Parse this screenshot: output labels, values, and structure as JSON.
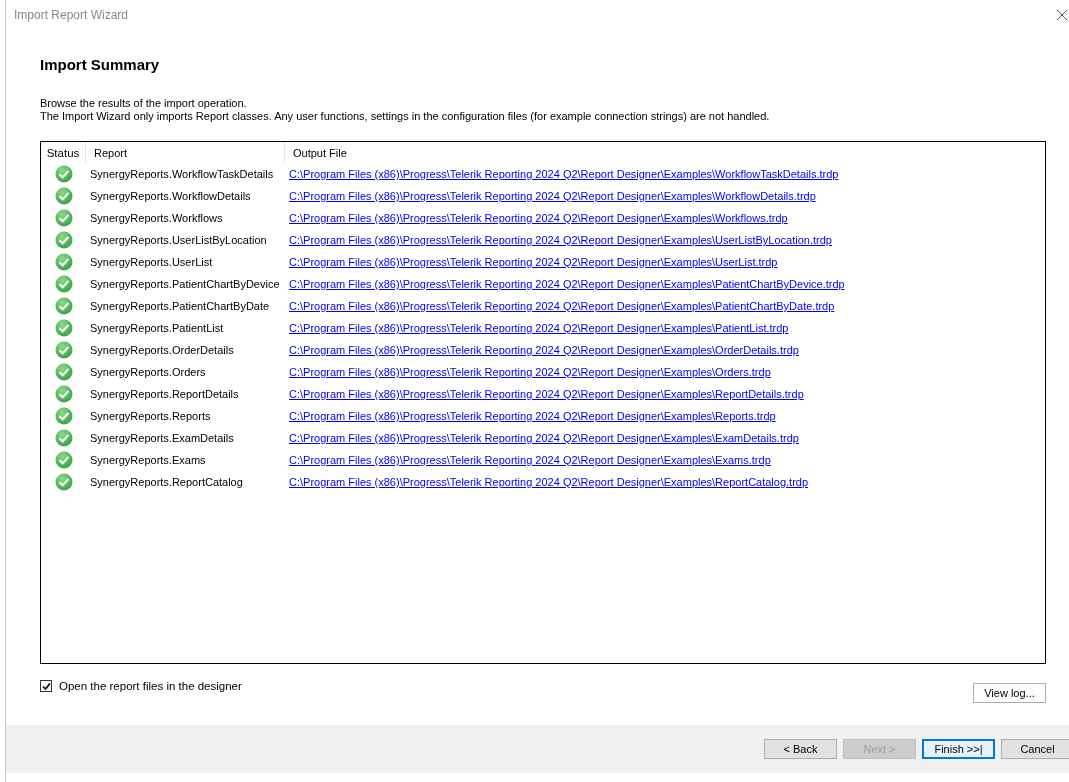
{
  "window": {
    "title": "Import Report Wizard"
  },
  "page": {
    "heading": "Import Summary",
    "intro": [
      "Browse the results of the import operation.",
      "The Import Wizard only imports Report classes. Any user functions, settings in the configuration files (for example connection strings) are not handled."
    ]
  },
  "table": {
    "columns": [
      "Status",
      "Report",
      "Output File"
    ],
    "rows": [
      {
        "succeeded": true,
        "report": "SynergyReports.WorkflowTaskDetails",
        "output_file": "C:\\Program Files (x86)\\Progress\\Telerik Reporting 2024 Q2\\Report Designer\\Examples\\WorkflowTaskDetails.trdp"
      },
      {
        "succeeded": true,
        "report": "SynergyReports.WorkflowDetails",
        "output_file": "C:\\Program Files (x86)\\Progress\\Telerik Reporting 2024 Q2\\Report Designer\\Examples\\WorkflowDetails.trdp"
      },
      {
        "succeeded": true,
        "report": "SynergyReports.Workflows",
        "output_file": "C:\\Program Files (x86)\\Progress\\Telerik Reporting 2024 Q2\\Report Designer\\Examples\\Workflows.trdp"
      },
      {
        "succeeded": true,
        "report": "SynergyReports.UserListByLocation",
        "output_file": "C:\\Program Files (x86)\\Progress\\Telerik Reporting 2024 Q2\\Report Designer\\Examples\\UserListByLocation.trdp"
      },
      {
        "succeeded": true,
        "report": "SynergyReports.UserList",
        "output_file": "C:\\Program Files (x86)\\Progress\\Telerik Reporting 2024 Q2\\Report Designer\\Examples\\UserList.trdp"
      },
      {
        "succeeded": true,
        "report": "SynergyReports.PatientChartByDevice",
        "output_file": "C:\\Program Files (x86)\\Progress\\Telerik Reporting 2024 Q2\\Report Designer\\Examples\\PatientChartByDevice.trdp"
      },
      {
        "succeeded": true,
        "report": "SynergyReports.PatientChartByDate",
        "output_file": "C:\\Program Files (x86)\\Progress\\Telerik Reporting 2024 Q2\\Report Designer\\Examples\\PatientChartByDate.trdp"
      },
      {
        "succeeded": true,
        "report": "SynergyReports.PatientList",
        "output_file": "C:\\Program Files (x86)\\Progress\\Telerik Reporting 2024 Q2\\Report Designer\\Examples\\PatientList.trdp"
      },
      {
        "succeeded": true,
        "report": "SynergyReports.OrderDetails",
        "output_file": "C:\\Program Files (x86)\\Progress\\Telerik Reporting 2024 Q2\\Report Designer\\Examples\\OrderDetails.trdp"
      },
      {
        "succeeded": true,
        "report": "SynergyReports.Orders",
        "output_file": "C:\\Program Files (x86)\\Progress\\Telerik Reporting 2024 Q2\\Report Designer\\Examples\\Orders.trdp"
      },
      {
        "succeeded": true,
        "report": "SynergyReports.ReportDetails",
        "output_file": "C:\\Program Files (x86)\\Progress\\Telerik Reporting 2024 Q2\\Report Designer\\Examples\\ReportDetails.trdp"
      },
      {
        "succeeded": true,
        "report": "SynergyReports.Reports",
        "output_file": "C:\\Program Files (x86)\\Progress\\Telerik Reporting 2024 Q2\\Report Designer\\Examples\\Reports.trdp"
      },
      {
        "succeeded": true,
        "report": "SynergyReports.ExamDetails",
        "output_file": "C:\\Program Files (x86)\\Progress\\Telerik Reporting 2024 Q2\\Report Designer\\Examples\\ExamDetails.trdp"
      },
      {
        "succeeded": true,
        "report": "SynergyReports.Exams",
        "output_file": "C:\\Program Files (x86)\\Progress\\Telerik Reporting 2024 Q2\\Report Designer\\Examples\\Exams.trdp"
      },
      {
        "succeeded": true,
        "report": "SynergyReports.ReportCatalog",
        "output_file": "C:\\Program Files (x86)\\Progress\\Telerik Reporting 2024 Q2\\Report Designer\\Examples\\ReportCatalog.trdp"
      }
    ]
  },
  "open_in_designer": {
    "label": "Open the report files in the designer",
    "checked": true
  },
  "view_log_button": "View log...",
  "buttons": [
    {
      "label": "< Back",
      "disabled": false,
      "default": false
    },
    {
      "label": "Next >",
      "disabled": true,
      "default": false
    },
    {
      "label": "Finish >>|",
      "disabled": false,
      "default": true
    },
    {
      "label": "Cancel",
      "disabled": false,
      "default": false
    }
  ]
}
